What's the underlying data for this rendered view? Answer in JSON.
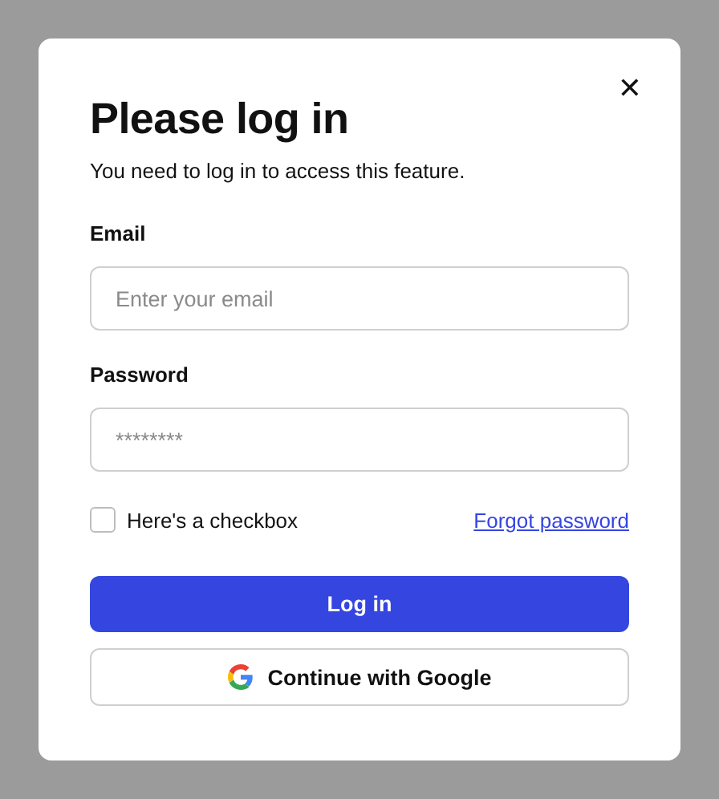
{
  "dialog": {
    "title": "Please log in",
    "subtitle": "You need to log in to access this feature.",
    "close": "✕"
  },
  "fields": [
    {
      "label": "Email",
      "placeholder": "Enter your email"
    },
    {
      "label": "Password",
      "placeholder": "********"
    }
  ],
  "checkbox": {
    "label": "Here's a checkbox",
    "checked": false
  },
  "link": "Forgot password",
  "buttons": [
    {
      "kind": "primary",
      "label": "Log in"
    },
    {
      "kind": "google",
      "label": "Continue with Google"
    }
  ]
}
